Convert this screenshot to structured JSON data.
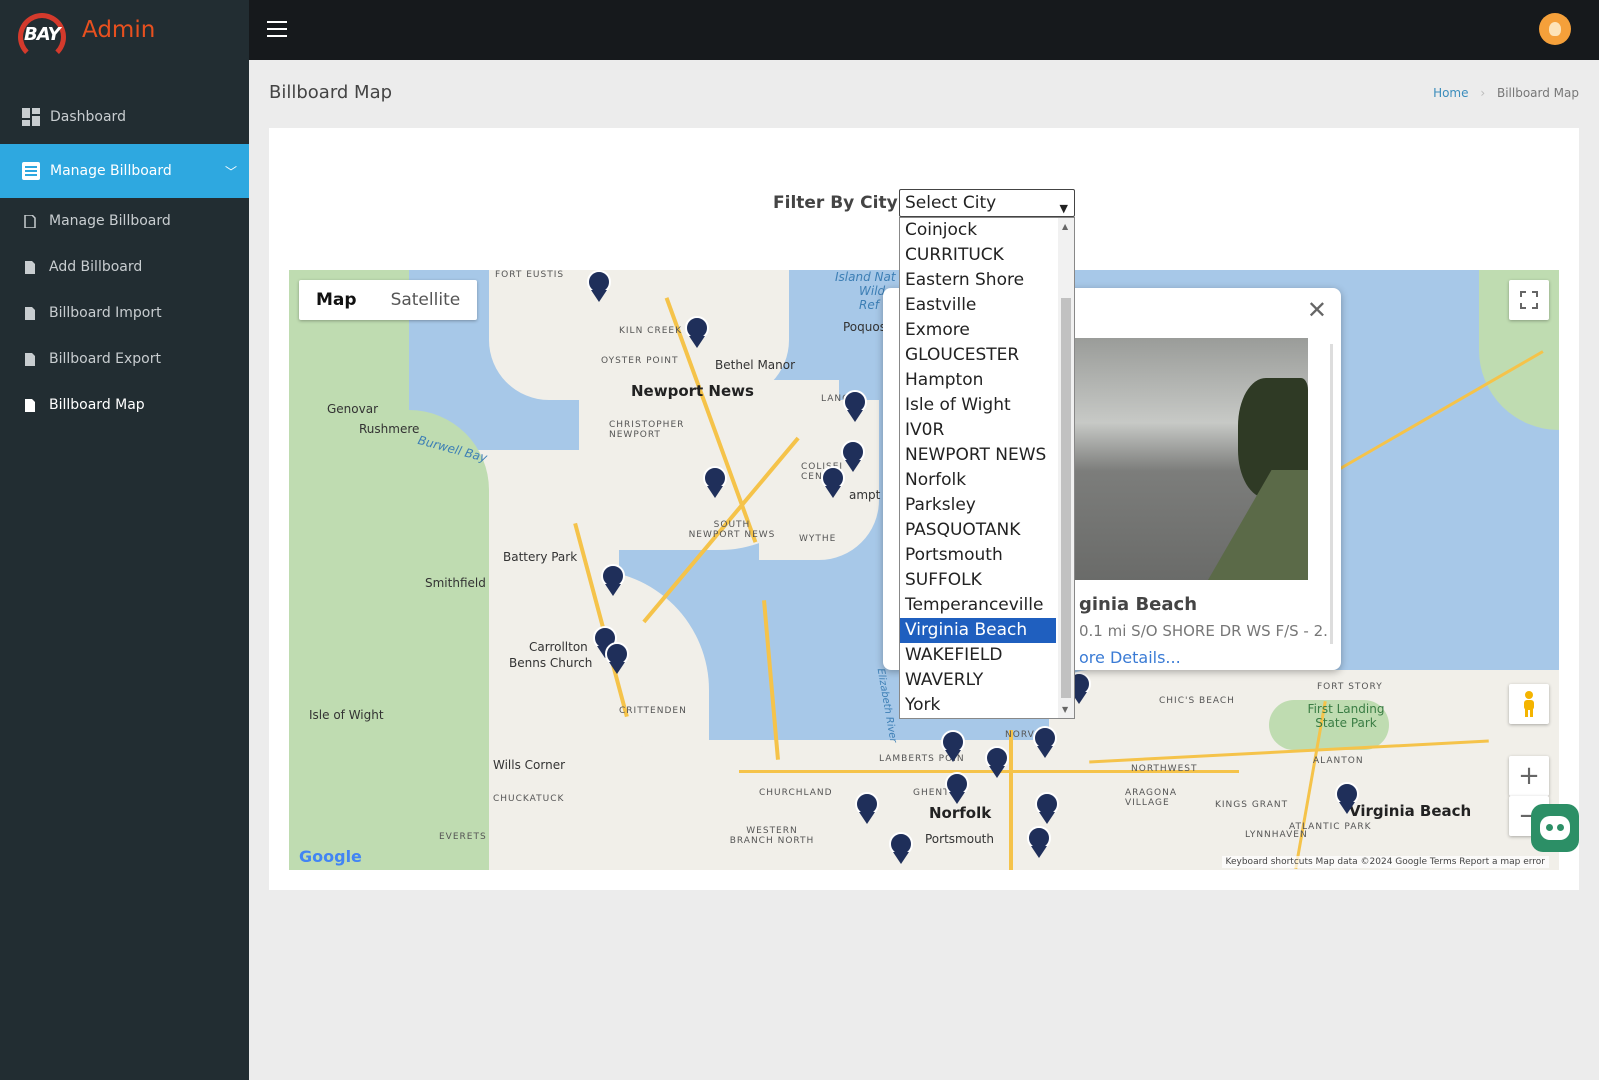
{
  "brand": {
    "logo_text": "BAY",
    "title": "Admin"
  },
  "sidebar": {
    "items": [
      {
        "label": "Dashboard",
        "icon": "dashboard-icon"
      },
      {
        "label": "Manage Billboard",
        "icon": "list-icon",
        "expanded": true
      }
    ],
    "subitems": [
      {
        "label": "Manage Billboard",
        "icon": "file-icon"
      },
      {
        "label": "Add Billboard",
        "icon": "file-icon"
      },
      {
        "label": "Billboard Import",
        "icon": "file-icon"
      },
      {
        "label": "Billboard Export",
        "icon": "file-icon"
      },
      {
        "label": "Billboard Map",
        "icon": "file-icon"
      }
    ]
  },
  "page": {
    "title": "Billboard Map",
    "breadcrumb": {
      "home": "Home",
      "current": "Billboard Map"
    }
  },
  "filter": {
    "label": "Filter By City :",
    "selected": "Select City",
    "options": [
      "Coinjock",
      "CURRITUCK",
      "Eastern Shore",
      "Eastville",
      "Exmore",
      "GLOUCESTER",
      "Hampton",
      "Isle of Wight",
      "IV0R",
      "NEWPORT NEWS",
      "Norfolk",
      "Parksley",
      "PASQUOTANK",
      "Portsmouth",
      "SUFFOLK",
      "Temperanceville",
      "Virginia Beach",
      "WAKEFIELD",
      "WAVERLY",
      "York"
    ],
    "highlighted": "Virginia Beach"
  },
  "map": {
    "type_map": "Map",
    "type_satellite": "Satellite",
    "google": "Google",
    "attribution": "Keyboard shortcuts   Map data ©2024 Google   Terms   Report a map error",
    "labels": {
      "newport_news": "Newport News",
      "norfolk": "Norfolk",
      "virginia_beach": "Virginia Beach",
      "smithfield": "Smithfield",
      "carrollton": "Carrollton",
      "benns_church": "Benns Church",
      "isle_of_wight": "Isle of Wight",
      "wills_corner": "Wills Corner",
      "rushmere": "Rushmere",
      "genovar": "Genovar",
      "battery_park": "Battery Park",
      "bethel_manor": "Bethel Manor",
      "poquoson": "Poquos",
      "first_landing": "First Landing State Park",
      "fort_eustis": "FORT EUSTIS",
      "kiln_creek": "KILN CREEK",
      "oyster_point": "OYSTER POINT",
      "christopher_newport": "CHRISTOPHER NEWPORT",
      "south_newport_news": "SOUTH NEWPORT NEWS",
      "wythe": "WYTHE",
      "crittenden": "CRITTENDEN",
      "chuckatuck": "CHUCKATUCK",
      "churchland": "CHURCHLAND",
      "everets": "EVERETS",
      "western_branch": "WESTERN BRANCH NORTH",
      "lamberts_point": "LAMBERTS POIN",
      "norview": "NORVIEW",
      "northwest": "NORTHWEST",
      "aragona": "ARAGONA VILLAGE",
      "kings_grant": "KINGS GRANT",
      "lynnhaven": "LYNNHAVEN",
      "chics_beach": "CHIC'S BEACH",
      "fort_story": "FORT STORY",
      "alanton": "ALANTON",
      "burwell_bay": "Burwell Bay",
      "elizabeth_river": "Elizabeth River",
      "portsmouth": "Portsmouth",
      "hampton_partial": "ampt",
      "island_nat": "Island Nat",
      "wild": "Wild",
      "ref": "Ref",
      "langley": "LANGLE",
      "coliseum": "COLISEI CENT",
      "ghent": "GHENT",
      "atlantic_park": "ATLANTIC PARK"
    }
  },
  "infowindow": {
    "place": "Virginia Beach",
    "place_visible": "ginia Beach",
    "description": "0.1 mi S/O SHORE DR WS F/S - 2.",
    "more": "More Details...",
    "more_visible": "ore Details..."
  }
}
